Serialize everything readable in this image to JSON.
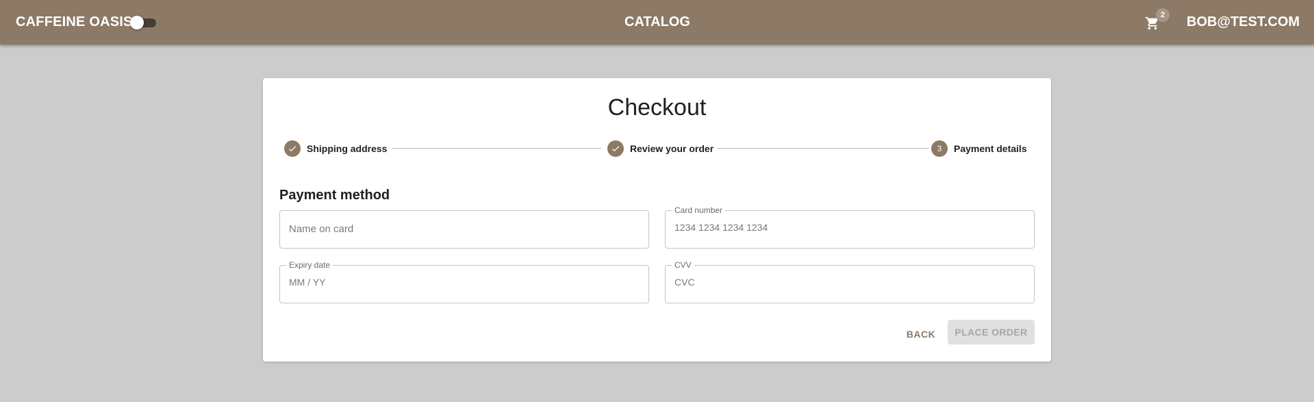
{
  "header": {
    "brand": "CAFFEINE OASIS",
    "nav_catalog": "CATALOG",
    "cart_count": "2",
    "user": "BOB@TEST.COM",
    "theme_toggle_on": false
  },
  "checkout": {
    "title": "Checkout",
    "steps": [
      {
        "label": "Shipping address",
        "state": "completed",
        "icon": "check-icon"
      },
      {
        "label": "Review your order",
        "state": "completed",
        "icon": "check-icon"
      },
      {
        "label": "Payment details",
        "state": "active",
        "number": "3"
      }
    ],
    "section_title": "Payment method",
    "fields": {
      "name_on_card": {
        "label": "",
        "placeholder": "Name on card",
        "value": ""
      },
      "card_number": {
        "label": "Card number",
        "placeholder": "1234 1234 1234 1234",
        "value": ""
      },
      "expiry": {
        "label": "Expiry date",
        "placeholder": "MM / YY",
        "value": ""
      },
      "cvv": {
        "label": "CVV",
        "placeholder": "CVC",
        "value": ""
      }
    },
    "buttons": {
      "back": "BACK",
      "place_order": "PLACE ORDER"
    }
  },
  "colors": {
    "appbar": "#8c7a66",
    "accent": "#8c7a66",
    "background": "#cccccc",
    "disabled_button": "#e0e0e0"
  }
}
